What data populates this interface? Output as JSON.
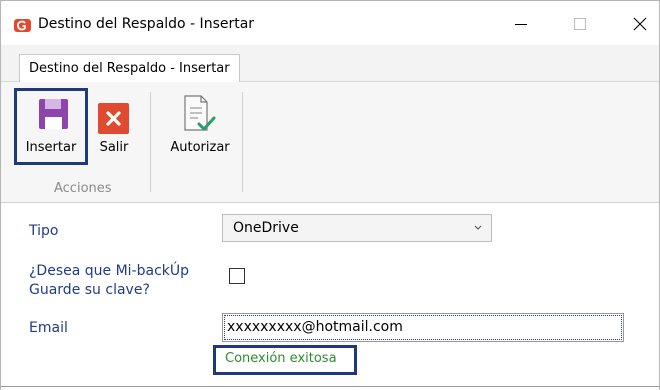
{
  "window": {
    "title": "Destino del Respaldo - Insertar",
    "controls": {
      "minimize": "—",
      "maximize": "☐",
      "close": "✕"
    }
  },
  "ribbon": {
    "tab": "Destino del Respaldo - Insertar",
    "buttons": {
      "insert": "Insertar",
      "exit": "Salir",
      "authorize": "Autorizar"
    },
    "group_label": "Acciones"
  },
  "form": {
    "tipo_label": "Tipo",
    "tipo_value": "OneDrive",
    "save_password_label": "¿Desea que Mi-backÚp Guarde su clave?",
    "save_password_checked": false,
    "email_label": "Email",
    "email_value": "xxxxxxxxx@hotmail.com",
    "status_text": "Conexión exitosa"
  },
  "colors": {
    "label_blue": "#1f3c8c",
    "status_green": "#2e8b2e",
    "highlight_border": "#1f3a78",
    "save_icon": "#8e44ad",
    "exit_icon": "#e04a30"
  },
  "icons": {
    "app": "app-logo-icon",
    "insert": "floppy-save-icon",
    "exit": "close-x-icon",
    "authorize": "document-check-icon",
    "select": "chevron-down-icon"
  }
}
